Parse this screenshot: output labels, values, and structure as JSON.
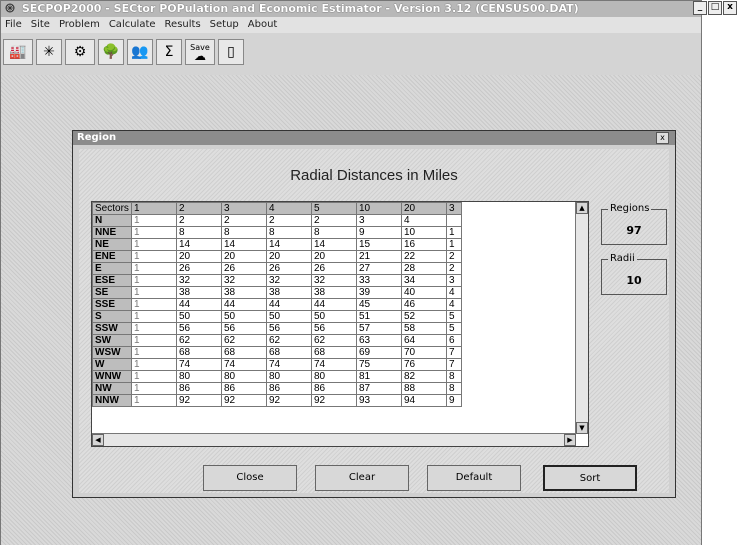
{
  "window": {
    "title": "SECPOP2000 - SECtor POPulation and Economic Estimator - Version 3.12   (CENSUS00.DAT)",
    "controls": [
      "_",
      "□",
      "x"
    ]
  },
  "menu": [
    "File",
    "Site",
    "Problem",
    "Calculate",
    "Results",
    "Setup",
    "About"
  ],
  "toolbar": [
    {
      "icon": "factory-icon",
      "glyph": "🏭"
    },
    {
      "icon": "compass-rose-icon",
      "glyph": "✳"
    },
    {
      "icon": "gears-icon",
      "glyph": "⚙"
    },
    {
      "icon": "tree-icon",
      "glyph": "🌳"
    },
    {
      "icon": "people-icon",
      "glyph": "👥"
    },
    {
      "icon": "sum-people-icon",
      "glyph": "Σ"
    },
    {
      "icon": "save-cloud-icon",
      "glyph": "☁",
      "label": "Save"
    },
    {
      "icon": "exit-door-icon",
      "glyph": "▯"
    }
  ],
  "dialog": {
    "title": "Region",
    "close": "x",
    "heading": "Radial Distances in Miles",
    "grid": {
      "header": [
        "Sectors",
        "1",
        "2",
        "3",
        "4",
        "5",
        "10",
        "20",
        "3"
      ],
      "rows": [
        [
          "N",
          "1",
          "2",
          "2",
          "2",
          "2",
          "3",
          "4",
          ""
        ],
        [
          "NNE",
          "1",
          "8",
          "8",
          "8",
          "8",
          "9",
          "10",
          "1"
        ],
        [
          "NE",
          "1",
          "14",
          "14",
          "14",
          "14",
          "15",
          "16",
          "1"
        ],
        [
          "ENE",
          "1",
          "20",
          "20",
          "20",
          "20",
          "21",
          "22",
          "2"
        ],
        [
          "E",
          "1",
          "26",
          "26",
          "26",
          "26",
          "27",
          "28",
          "2"
        ],
        [
          "ESE",
          "1",
          "32",
          "32",
          "32",
          "32",
          "33",
          "34",
          "3"
        ],
        [
          "SE",
          "1",
          "38",
          "38",
          "38",
          "38",
          "39",
          "40",
          "4"
        ],
        [
          "SSE",
          "1",
          "44",
          "44",
          "44",
          "44",
          "45",
          "46",
          "4"
        ],
        [
          "S",
          "1",
          "50",
          "50",
          "50",
          "50",
          "51",
          "52",
          "5"
        ],
        [
          "SSW",
          "1",
          "56",
          "56",
          "56",
          "56",
          "57",
          "58",
          "5"
        ],
        [
          "SW",
          "1",
          "62",
          "62",
          "62",
          "62",
          "63",
          "64",
          "6"
        ],
        [
          "WSW",
          "1",
          "68",
          "68",
          "68",
          "68",
          "69",
          "70",
          "7"
        ],
        [
          "W",
          "1",
          "74",
          "74",
          "74",
          "74",
          "75",
          "76",
          "7"
        ],
        [
          "WNW",
          "1",
          "80",
          "80",
          "80",
          "80",
          "81",
          "82",
          "8"
        ],
        [
          "NW",
          "1",
          "86",
          "86",
          "86",
          "86",
          "87",
          "88",
          "8"
        ],
        [
          "NNW",
          "1",
          "92",
          "92",
          "92",
          "92",
          "93",
          "94",
          "9"
        ]
      ]
    },
    "regions": {
      "label": "Regions",
      "value": "97"
    },
    "radii": {
      "label": "Radii",
      "value": "10"
    },
    "buttons": {
      "close": "Close",
      "clear": "Clear",
      "default": "Default",
      "sort": "Sort"
    }
  }
}
